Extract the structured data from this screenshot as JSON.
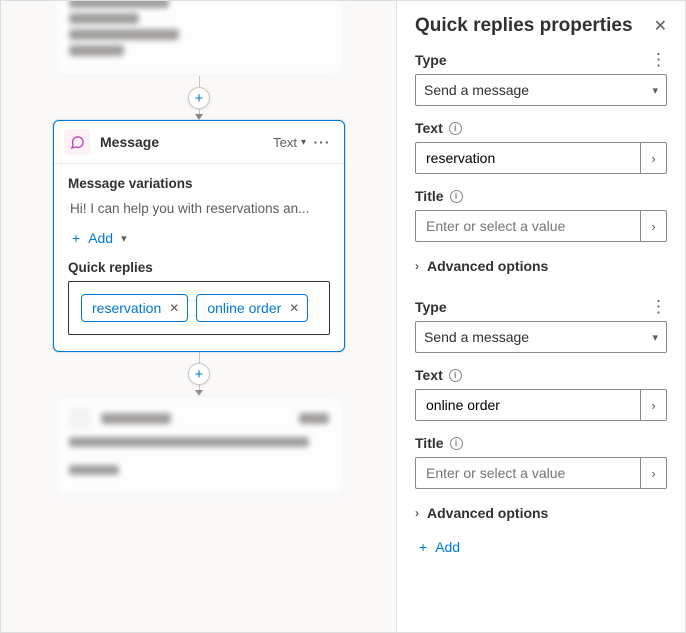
{
  "canvas": {
    "node": {
      "title": "Message",
      "type_button": "Text",
      "variations_label": "Message variations",
      "variation_text": "Hi! I can help you with reservations an...",
      "add_label": "Add",
      "quick_replies_label": "Quick replies",
      "chips": [
        "reservation",
        "online order"
      ]
    }
  },
  "panel": {
    "title": "Quick replies properties",
    "replies": [
      {
        "type_label": "Type",
        "type_value": "Send a message",
        "text_label": "Text",
        "text_value": "reservation",
        "title_label": "Title",
        "title_placeholder": "Enter or select a value",
        "advanced_label": "Advanced options"
      },
      {
        "type_label": "Type",
        "type_value": "Send a message",
        "text_label": "Text",
        "text_value": "online order",
        "title_label": "Title",
        "title_placeholder": "Enter or select a value",
        "advanced_label": "Advanced options"
      }
    ],
    "add_label": "Add"
  }
}
